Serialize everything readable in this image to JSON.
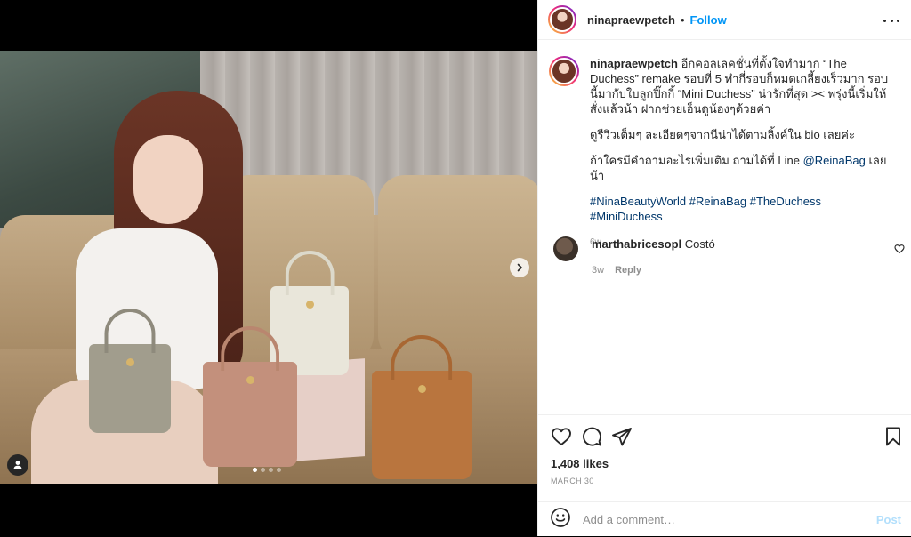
{
  "post": {
    "author": "ninapraewpetch",
    "follow_label": "Follow",
    "separator": "•",
    "more_icon": "more-horizontal-icon",
    "media": {
      "carousel_count": 4,
      "active_index": 0,
      "next_icon": "chevron-right-icon",
      "tag_icon": "user-tag-icon"
    },
    "caption": {
      "line1": "อีกคอลเลคชั่นที่ตั้งใจทำมาก “The Duchess” remake รอบที่ 5 ทำกี่รอบก็หมดเกลี้ยงเร็วมาก รอบนี้มากับใบลูกปิ๊กกี้ “Mini Duchess” น่ารักที่สุด >< พรุ่งนี้เริ่มให้สั่งแล้วน้า ฝากช่วยเอ็นดูน้องๆด้วยค่า",
      "line2": "ดูรีวิวเต็มๆ ละเอียดๆจากนีน่าได้ตามลิ้งค์ใน bio เลยค่ะ",
      "line3_prefix": "ถ้าใครมีคำถามอะไรเพิ่มเติม ถามได้ที่ Line ",
      "line3_mention": "@ReinaBag",
      "line3_suffix": " เลยน้า",
      "hashtags": [
        "#NinaBeautyWorld",
        "#ReinaBag",
        "#TheDuchess",
        "#MiniDuchess"
      ],
      "time": "6w"
    },
    "comments": [
      {
        "username": "marthabricesopl",
        "text": "Costó",
        "time": "3w",
        "reply_label": "Reply"
      }
    ],
    "actions": {
      "like_icon": "heart-icon",
      "comment_icon": "comment-icon",
      "share_icon": "share-icon",
      "save_icon": "bookmark-icon"
    },
    "likes": "1,408 likes",
    "date": "MARCH 30",
    "add_comment": {
      "emoji_icon": "emoji-icon",
      "placeholder": "Add a comment…",
      "post_label": "Post"
    }
  },
  "colors": {
    "accent": "#0095f6",
    "link": "#00376b",
    "muted": "#8e8e8e",
    "post_disabled": "#b2dffc"
  }
}
